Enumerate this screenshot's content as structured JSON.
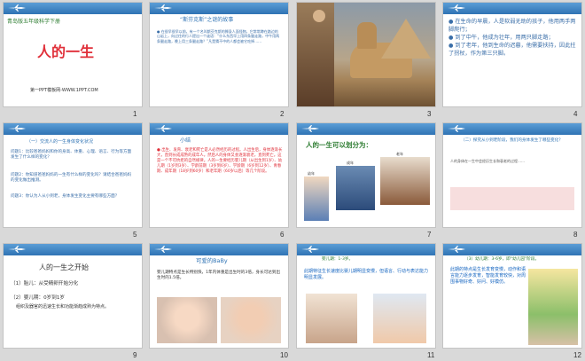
{
  "slides": [
    {
      "num": "1",
      "top_tag": "青岛版五年级科学下册",
      "title": "人的一生",
      "footer": "第一PPT模板网-WWW.1PPT.COM"
    },
    {
      "num": "2",
      "heading": "“斯芬克斯”之谜的故事",
      "body": "● 在很早很早以前，有一个名叫斯芬克斯的狮身人面怪物，它常常蹲在路边的山岩上，向过往的行人提出一个谜语：“什么东西早上用四条腿走路，中午用两条腿走路，晚上用三条腿走路？”凡是猜不中的人都会被它吃掉……"
    },
    {
      "num": "3"
    },
    {
      "num": "4",
      "body": "● 在生命的早晨，人是软弱无助的孩子，他用两手两脚爬行；\n● 到了中午，他成为壮年，用两只脚走路；\n● 到了老年，他到生命的迟暮，他需要扶持，因此拄了拐杖，作为第三只脚。"
    },
    {
      "num": "5",
      "heading": "（一）交流人的一生身体变化状况",
      "q1": "问题1：比较爸爸妈妈和你的身高、体重、心理、语言、行为等方面发生了什么样的变化？",
      "q2": "问题2：你知道爸爸妈妈的一生有什么样的变化吗？请结合爸爸妈妈的变化做出推测。",
      "q3": "问题3：你认为人从小到老，身体发生变化主要有哪些方面？"
    },
    {
      "num": "6",
      "heading": "小结",
      "body": "● 出生、发育、衰老和死亡是人必然经历的过程。人出生后，身体逐渐长大，直到长成成熟的成年人。然后人的身体又会逐渐衰老，直到死亡。这是一个不可抗拒的自然规律。人的一生要经历婴儿期（从出生到1岁）、幼儿期（1岁到3岁）、学龄前期（3岁到6岁）、学龄期（6岁到12岁）、青春期、成年期（18岁到60岁）和老年期（60岁以后）等几个阶段。"
    },
    {
      "num": "7",
      "title": "人的一生可以划分为：",
      "labels": [
        "幼年",
        "成年",
        "老年"
      ]
    },
    {
      "num": "8",
      "heading": "（二）探究从小到老阶段，我们的身体发生了哪些变化？",
      "body": "人的身体在一生中会经历生长和衰老的过程……"
    },
    {
      "num": "9",
      "title": "人的一生之开始",
      "item1": "（1）胎儿：从受精卵开始分化",
      "item2": "（2）婴儿期：0岁到1岁",
      "item3": "组织及器官的迅速生长和功能渐趋成熟为特点。"
    },
    {
      "num": "10",
      "title": "可爱的BaBy",
      "text": "婴儿期特点是生长特别快，1年内体重是出生时的3倍，身长可达到出生时的1.5倍。"
    },
    {
      "num": "11",
      "heading": "婴儿期：1-3岁。",
      "text": "此期特征生长速度比婴儿期明显变慢，但语言、行动与表达能力明显发展。"
    },
    {
      "num": "12",
      "heading": "（3）幼儿期：3-6岁，即“幼儿园”阶段。",
      "text": "此期的特点是生长发育变慢，动作和语言能力逐步发育，智能发育较快，对周围事物好奇、好问、好模仿。"
    }
  ],
  "colors": {
    "band": "#2f73b4",
    "accent_red": "#e0303a",
    "background": "#d9d9d9"
  }
}
